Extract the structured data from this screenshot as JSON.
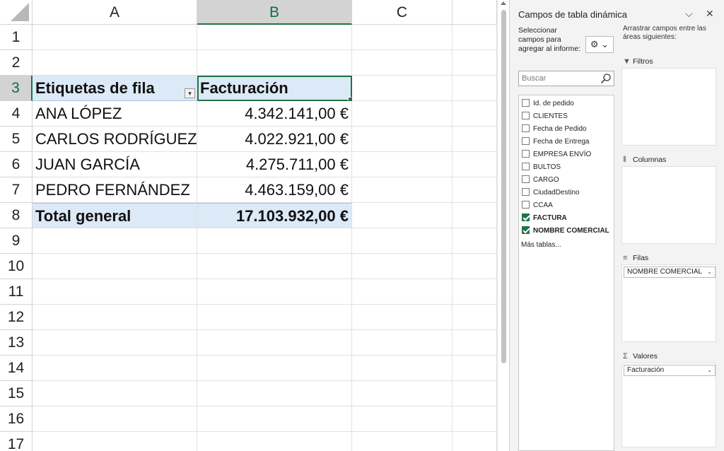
{
  "sheet": {
    "columns": [
      "A",
      "B",
      "C"
    ],
    "rows": [
      "1",
      "2",
      "3",
      "4",
      "5",
      "6",
      "7",
      "8",
      "9",
      "10",
      "11",
      "12",
      "13",
      "14",
      "15",
      "16",
      "17"
    ],
    "pivot": {
      "row_label_header": "Etiquetas de fila",
      "value_header": "Facturación",
      "filter_glyph": "▾",
      "items": [
        {
          "name": "ANA LÓPEZ",
          "value": "4.342.141,00 €"
        },
        {
          "name": "CARLOS RODRÍGUEZ",
          "value": "4.022.921,00 €"
        },
        {
          "name": "JUAN GARCÍA",
          "value": "4.275.711,00 €"
        },
        {
          "name": "PEDRO FERNÁNDEZ",
          "value": "4.463.159,00 €"
        }
      ],
      "total_label": "Total general",
      "total_value": "17.103.932,00 €"
    }
  },
  "pane": {
    "title": "Campos de tabla dinámica",
    "collapse_glyph": "⌵",
    "close_glyph": "✕",
    "select_label": "Seleccionar campos para agregar al informe:",
    "tools_glyph": "⚙ ⌄",
    "search_placeholder": "Buscar",
    "fields": [
      {
        "label": "Id. de pedido",
        "checked": false
      },
      {
        "label": "CLIENTES",
        "checked": false
      },
      {
        "label": "Fecha de Pedido",
        "checked": false
      },
      {
        "label": "Fecha de Entrega",
        "checked": false
      },
      {
        "label": "EMPRESA ENVÍO",
        "checked": false
      },
      {
        "label": "BULTOS",
        "checked": false
      },
      {
        "label": "CARGO",
        "checked": false
      },
      {
        "label": "CiudadDestino",
        "checked": false
      },
      {
        "label": "CCAA",
        "checked": false
      },
      {
        "label": "FACTURA",
        "checked": true
      },
      {
        "label": "NOMBRE COMERCIAL",
        "checked": true
      }
    ],
    "more_tables": "Más tablas...",
    "drag_hint": "Arrastrar campos entre las áreas siguientes:",
    "areas": {
      "filters": {
        "label": "Filtros",
        "icon": "filter-icon",
        "glyph": "▼"
      },
      "columns": {
        "label": "Columnas",
        "icon": "columns-icon",
        "glyph": "⦀"
      },
      "rows": {
        "label": "Filas",
        "icon": "rows-icon",
        "glyph": "≡",
        "chip": "NOMBRE COMERCIAL"
      },
      "values": {
        "label": "Valores",
        "icon": "sigma-icon",
        "glyph": "Σ",
        "chip": "Facturación"
      }
    },
    "chip_caret": "⌄"
  }
}
